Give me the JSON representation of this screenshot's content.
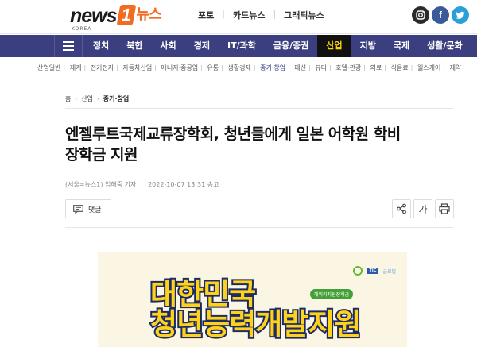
{
  "logo": {
    "news": "news",
    "one": "1",
    "kr": "뉴스",
    "sub": "KOREA"
  },
  "topnav": [
    "포토",
    "카드뉴스",
    "그래픽뉴스"
  ],
  "social": {
    "instagram": "instagram-icon",
    "facebook": "f",
    "twitter": "twitter-icon"
  },
  "mainnav": {
    "tabs": [
      "정치",
      "북한",
      "사회",
      "경제",
      "IT/과학",
      "금융/증권",
      "산업",
      "지방",
      "국제",
      "생활/문화"
    ],
    "active": "산업"
  },
  "subnav": {
    "items": [
      "산업일반",
      "재계",
      "전기전자",
      "자동차산업",
      "에너지·중공업",
      "유통",
      "생활경제",
      "중기·창업",
      "패션",
      "뷰티",
      "호텔·관광",
      "의료",
      "식음료",
      "웰스케어",
      "제약"
    ],
    "current": "중기·창업"
  },
  "breadcrumb": {
    "home": "홈",
    "section": "산업",
    "current": "중기·창업"
  },
  "article": {
    "headline_line1": "엔젤루트국제교류장학회, 청년들에게 일본 어학원 학비",
    "headline_line2": "장학금 지원",
    "byline_source": "(서울=뉴스1) 임해중 기자",
    "byline_time": "2022-10-07 13:31 송고",
    "comment_label": "댓글"
  },
  "tools": {
    "share": "share-icon",
    "font": "가",
    "print": "print-icon"
  },
  "figure": {
    "line1": "대한민국",
    "line2": "청년능력개발지원",
    "tag": "해외리지원장학금",
    "logo_a": "TIC",
    "logo_b": "글로벌"
  }
}
